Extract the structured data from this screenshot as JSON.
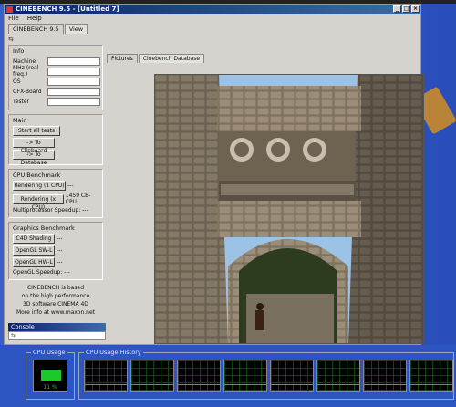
{
  "window": {
    "title": "CINEBENCH 9.5 - [Untitled 7]"
  },
  "menu": [
    "File",
    "Help"
  ],
  "top_tabs": [
    "CINEBENCH 9.5",
    "View"
  ],
  "info": {
    "title": "Info",
    "rows": [
      "Machine",
      "MHz (real freq.)",
      "OS",
      "GFX-Board",
      "Tester"
    ]
  },
  "main": {
    "title": "Main",
    "buttons": [
      "Start all tests",
      "-> To Clipboard",
      "-> To Database"
    ]
  },
  "cpu_bench": {
    "title": "CPU Benchmark",
    "rendering_1": {
      "label": "Rendering (1 CPU)",
      "result": "---"
    },
    "rendering_x": {
      "label": "Rendering (x CPU)",
      "result": "1459 CB-CPU"
    },
    "speedup": "Multiprocessor Speedup: ---"
  },
  "gfx_bench": {
    "title": "Graphics Benchmark",
    "c4d": {
      "label": "C4D Shading",
      "result": "---"
    },
    "sw": {
      "label": "OpenGL SW-L",
      "result": "---"
    },
    "hw": {
      "label": "OpenGL HW-L",
      "result": "---"
    },
    "speedup": "OpenGL Speedup: ---"
  },
  "about": [
    "CINEBENCH is based",
    "on the high performance",
    "3D software CINEMA 4D",
    "More info at www.maxon.net"
  ],
  "console": {
    "title": "Console"
  },
  "right_tabs": [
    "Pictures",
    "Cinebench Database"
  ],
  "taskmgr": {
    "cpu_usage_title": "CPU Usage",
    "cpu_usage_value": "11 %",
    "cpu_usage_fraction": 0.11,
    "history_title": "CPU Usage History",
    "history_graph_count": 8
  },
  "colors": {
    "titlebar": "#0a246a",
    "graph_line": "#1dc82a",
    "desktop": "#2f56c6"
  }
}
